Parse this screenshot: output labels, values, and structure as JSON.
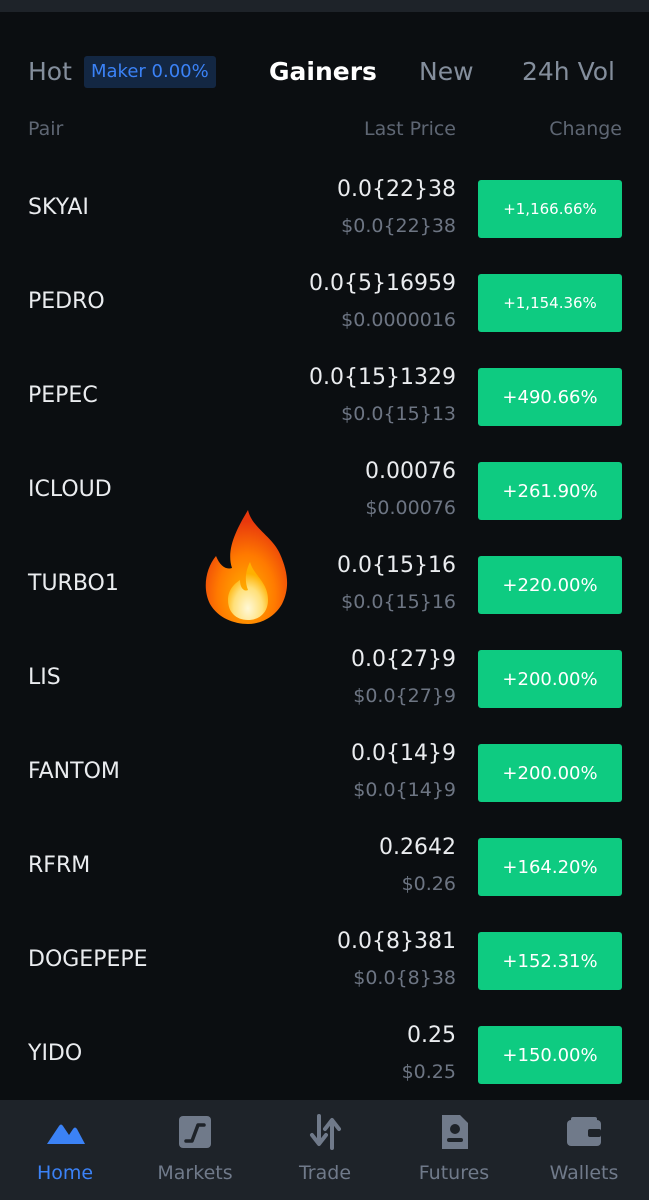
{
  "tabs": [
    {
      "label": "Hot"
    },
    {
      "label": "Gainers"
    },
    {
      "label": "New"
    },
    {
      "label": "24h Vol"
    }
  ],
  "active_tab": "Gainers",
  "maker_badge": "Maker 0.00%",
  "columns": {
    "pair": "Pair",
    "last_price": "Last Price",
    "change": "Change"
  },
  "rows": [
    {
      "pair": "SKYAI",
      "price": "0.0{22}38",
      "usd": "$0.0{22}38",
      "change": "+1,166.66%"
    },
    {
      "pair": "PEDRO",
      "price": "0.0{5}16959",
      "usd": "$0.0000016",
      "change": "+1,154.36%"
    },
    {
      "pair": "PEPEC",
      "price": "0.0{15}1329",
      "usd": "$0.0{15}13",
      "change": "+490.66%"
    },
    {
      "pair": "ICLOUD",
      "price": "0.00076",
      "usd": "$0.00076",
      "change": "+261.90%"
    },
    {
      "pair": "TURBO1",
      "price": "0.0{15}16",
      "usd": "$0.0{15}16",
      "change": "+220.00%"
    },
    {
      "pair": "LIS",
      "price": "0.0{27}9",
      "usd": "$0.0{27}9",
      "change": "+200.00%"
    },
    {
      "pair": "FANTOM",
      "price": "0.0{14}9",
      "usd": "$0.0{14}9",
      "change": "+200.00%"
    },
    {
      "pair": "RFRM",
      "price": "0.2642",
      "usd": "$0.26",
      "change": "+164.20%"
    },
    {
      "pair": "DOGEPEPE",
      "price": "0.0{8}381",
      "usd": "$0.0{8}38",
      "change": "+152.31%"
    },
    {
      "pair": "YIDO",
      "price": "0.25",
      "usd": "$0.25",
      "change": "+150.00%"
    }
  ],
  "overlay_icon": "fire-emoji-icon",
  "bottom_nav": [
    {
      "label": "Home",
      "icon": "home-icon"
    },
    {
      "label": "Markets",
      "icon": "markets-icon"
    },
    {
      "label": "Trade",
      "icon": "trade-arrows-icon"
    },
    {
      "label": "Futures",
      "icon": "futures-icon"
    },
    {
      "label": "Wallets",
      "icon": "wallet-icon"
    }
  ],
  "colors": {
    "background": "#0b0e11",
    "gain_green": "#0ecb81",
    "accent_blue": "#3b82f6",
    "nav_bg": "#1e2329"
  }
}
